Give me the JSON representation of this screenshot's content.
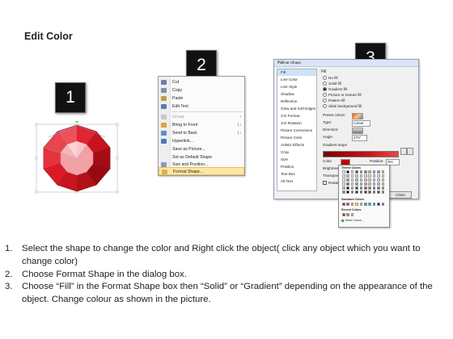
{
  "title": "Edit Color",
  "steps": [
    {
      "number": "1"
    },
    {
      "number": "2"
    },
    {
      "number": "3"
    }
  ],
  "context_menu": {
    "items": [
      {
        "label": "Cut",
        "icon": "scissors-icon",
        "disabled": false,
        "submenu": false
      },
      {
        "label": "Copy",
        "icon": "copy-icon",
        "disabled": false,
        "submenu": false
      },
      {
        "label": "Paste",
        "icon": "paste-icon",
        "disabled": false,
        "submenu": false
      },
      {
        "label": "Edit Text",
        "icon": "edit-text-icon",
        "disabled": false,
        "submenu": false
      },
      {
        "label": "Group",
        "icon": "group-icon",
        "disabled": true,
        "submenu": true
      },
      {
        "label": "Bring to Front",
        "icon": "bring-front-icon",
        "disabled": false,
        "submenu": true
      },
      {
        "label": "Send to Back",
        "icon": "send-back-icon",
        "disabled": false,
        "submenu": true
      },
      {
        "label": "Hyperlink...",
        "icon": "hyperlink-icon",
        "disabled": false,
        "submenu": false
      },
      {
        "label": "Save as Picture...",
        "icon": "",
        "disabled": false,
        "submenu": false
      },
      {
        "label": "Set as Default Shape",
        "icon": "",
        "disabled": false,
        "submenu": false
      },
      {
        "label": "Size and Position...",
        "icon": "size-icon",
        "disabled": false,
        "submenu": false
      },
      {
        "label": "Format Shape...",
        "icon": "format-shape-icon",
        "disabled": false,
        "submenu": false,
        "highlighted": true
      }
    ]
  },
  "dialog": {
    "title": "Format Shape",
    "close": "?  X",
    "nav_items": [
      "Fill",
      "Line Color",
      "Line Style",
      "Shadow",
      "Reflection",
      "Glow and Soft Edges",
      "3-D Format",
      "3-D Rotation",
      "Picture Corrections",
      "Picture Color",
      "Artistic Effects",
      "Crop",
      "Size",
      "Position",
      "Text Box",
      "Alt Text"
    ],
    "selected_nav": "Fill",
    "fill_heading": "Fill",
    "fill_options": [
      "No fill",
      "Solid fill",
      "Gradient fill",
      "Picture or texture fill",
      "Pattern fill",
      "Slide background fill"
    ],
    "selected_fill": "Gradient fill",
    "preset_label": "Preset colors:",
    "type_label": "Type:",
    "type_value": "Linear",
    "direction_label": "Direction:",
    "angle_label": "Angle:",
    "angle_value": "270°",
    "gradient_stops_label": "Gradient stops",
    "color_label": "Color",
    "position_label": "Position:",
    "position_value": "0%",
    "brightness_label": "Brightness:",
    "transparency_label": "Transparency:",
    "rotate_label": "Rotate w",
    "close_button": "Close"
  },
  "palette": {
    "theme_label": "Theme Colors",
    "standard_label": "Standard Colors",
    "recent_label": "Recent Colors",
    "more_label": "More Colors...",
    "theme_top": [
      "#ffffff",
      "#000000",
      "#eeece1",
      "#1f497d",
      "#4f81bd",
      "#c0504d",
      "#9bbb59",
      "#8064a2",
      "#4bacc6",
      "#f79646"
    ],
    "standard": [
      "#c00000",
      "#ff0000",
      "#ffc000",
      "#ffff00",
      "#92d050",
      "#00b050",
      "#00b0f0",
      "#0070c0",
      "#002060",
      "#7030a0"
    ],
    "recent": [
      "#c00000",
      "#ff6060",
      "#ff9999"
    ]
  },
  "instructions": [
    {
      "num": "1.",
      "text": "Select the shape to change the color and Right click the object( click any object which you want to change color)"
    },
    {
      "num": "2.",
      "text": "Choose Format Shape in the dialog box."
    },
    {
      "num": "3.",
      "text": "Choose “Fill” in the Format Shape box then “Solid” or “Gradient” depending on the appearance of the object. Change colour as shown in the picture."
    }
  ],
  "colors": {
    "shape_red": "#d0121c",
    "shape_dark_red": "#8e0a10",
    "shape_pink": "#f3a3a8",
    "menu_highlight": "#fde7a2"
  }
}
